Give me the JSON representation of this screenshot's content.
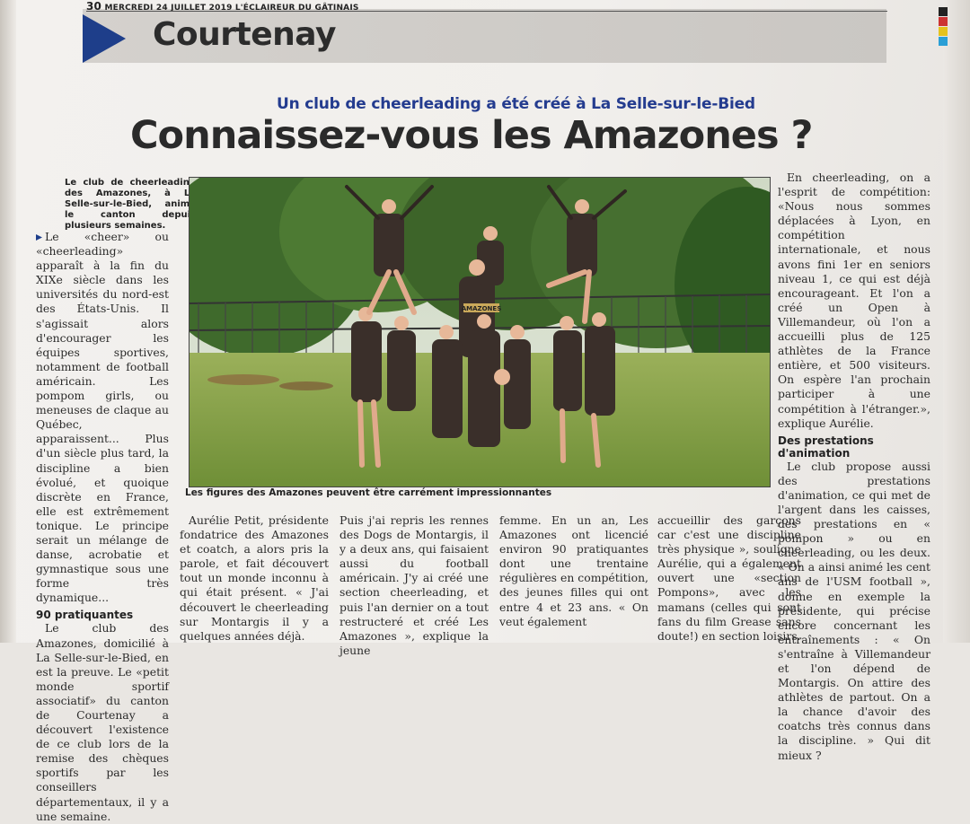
{
  "folio": {
    "page_number": "30",
    "text": "MERCREDI 24 JUILLET 2019 L'ÉCLAIREUR DU GÂTINAIS"
  },
  "rubric": "Courtenay",
  "kicker": "Un club de cheerleading a été créé à La Selle-sur-le-Bied",
  "headline": "Connaissez-vous les Amazones ?",
  "lead": "Le club de cheerleading des Amazones, à La Selle-sur-le-Bied, anime le canton depuis plusieurs semaines.",
  "caption": "Les figures des Amazones peuvent être carrément impressionnantes",
  "col1": {
    "para1": "Le «cheer» ou «cheerleading» apparaît à la fin du XIXe siècle dans les universités du nord-est des États-Unis. Il s'agissait alors d'encourager les équipes sportives, notamment de football américain. Les pompom girls, ou meneuses de claque au Québec, apparaissent... Plus d'un siècle plus tard, la discipline a bien évolué, et quoique discrète en France, elle est extrêmement tonique. Le principe serait un mélange de danse, acrobatie et gymnastique sous une forme très dynamique...",
    "subhead": "90 pratiquantes",
    "para2": "Le club des Amazones, domicilié à La Selle-sur-le-Bied, en est la preuve. Le «petit monde sportif associatif» du canton de Courtenay a découvert l'existence de ce club lors de la remise des chèques sportifs par les conseillers départementaux, il y a une semaine."
  },
  "col2": "Aurélie Petit, présidente fondatrice des Amazones et coatch, a alors pris la parole, et fait découvert tout un monde inconnu à qui était présent. « J'ai découvert le cheerleading sur Montargis il y a quelques années déjà.",
  "col3": "Puis j'ai repris les rennes des Dogs de Montargis, il y a deux ans, qui faisaient aussi du football américain. J'y ai créé une section cheerleading, et puis l'an dernier on a tout restructeré et créé Les Amazones », explique la jeune",
  "col4": "femme. En un an, Les Amazones ont licencié environ 90 pratiquantes dont une trentaine régulières en compétition, des jeunes filles qui ont entre 4 et 23 ans. « On veut également",
  "col5": "accueillir des garçons car c'est une discipline très physique », souligne Aurélie, qui a également ouvert une «section Pompons», avec les mamans (celles qui sont fans du film Grease sans doute!) en section loisirs.",
  "col6": {
    "para1": "En cheerleading, on a l'esprit de compétition: «Nous nous sommes déplacées à Lyon, en compétition internationale, et nous avons fini 1er en seniors niveau 1, ce qui est déjà encourageant. Et l'on a créé un Open à Villemandeur, où l'on a accueilli plus de 125 athlètes de la France entière, et 500 visiteurs. On espère l'an prochain participer à une compétition à l'étranger.», explique Aurélie.",
    "subhead": "Des prestations d'animation",
    "para2": "Le club propose aussi des prestations d'animation, ce qui met de l'argent dans les caisses, des prestations en « pompon » ou en cheerleading, ou les deux. « On a ainsi animé les cent ans de l'USM football », donne en exemple la présidente, qui précise encore concernant les entraînements : « On s'entraîne à Villemandeur et l'on dépend de Montargis. On attire des athlètes de partout. On a la chance d'avoir des coatchs très connus dans la discipline. » Qui dit mieux ?"
  },
  "colors": {
    "accent_blue": "#1e3e8a",
    "kicker_blue": "#243c8f",
    "band_gray": "#cecbc7",
    "ink": "#2a2a2a"
  },
  "photo": {
    "description_icon": "cheerleaders-photo",
    "jersey_text": "AMAZONES"
  }
}
